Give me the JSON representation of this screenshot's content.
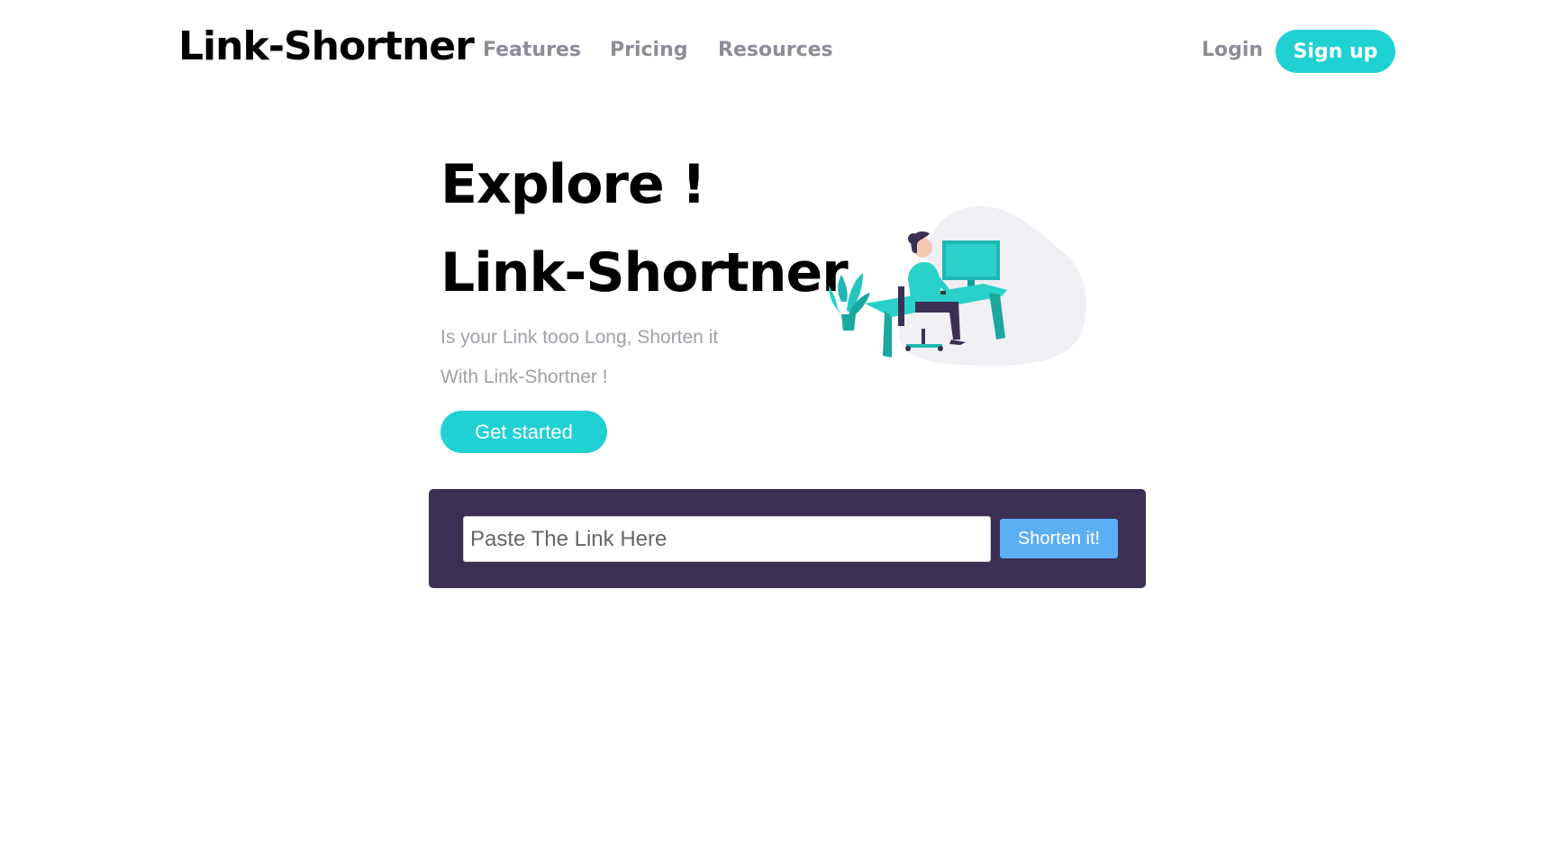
{
  "header": {
    "logo": "Link-Shortner",
    "nav": [
      {
        "label": "Features"
      },
      {
        "label": "Pricing"
      },
      {
        "label": "Resources"
      }
    ],
    "login_label": "Login",
    "signup_label": "Sign up"
  },
  "hero": {
    "title_line1": "Explore !",
    "title_line2": "Link-Shortner",
    "desc_line1": "Is your Link tooo Long, Shorten it",
    "desc_line2": "With Link-Shortner !",
    "cta_label": "Get started"
  },
  "shortener": {
    "input_placeholder": "Paste The Link Here",
    "input_value": "",
    "button_label": "Shorten it!"
  },
  "colors": {
    "accent": "#20d1d3",
    "nav_text": "#8d8d99",
    "panel_bg": "#3b3054",
    "shorten_button": "#5aaef2"
  },
  "icons": {
    "illustration": "person-working-at-desk-illustration"
  }
}
